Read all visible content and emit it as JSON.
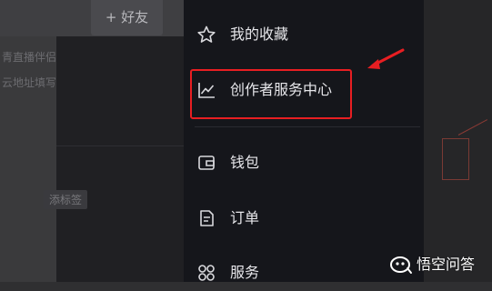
{
  "background_app": {
    "friend_button_label": "+ 好友",
    "text_line_1": "青直播伴侣",
    "text_line_2": "云地址填写",
    "tag_label": "添标签"
  },
  "drawer": {
    "items": [
      {
        "label": "我的收藏",
        "icon": "star-icon"
      },
      {
        "label": "创作者服务中心",
        "icon": "chart-line-icon"
      },
      {
        "label": "钱包",
        "icon": "wallet-icon"
      },
      {
        "label": "订单",
        "icon": "order-icon"
      },
      {
        "label": "服务",
        "icon": "grid-icon"
      }
    ]
  },
  "annotation": {
    "highlight_color": "#e81e22",
    "highlighted_item": "创作者服务中心"
  },
  "watermark": {
    "text": "悟空问答"
  }
}
